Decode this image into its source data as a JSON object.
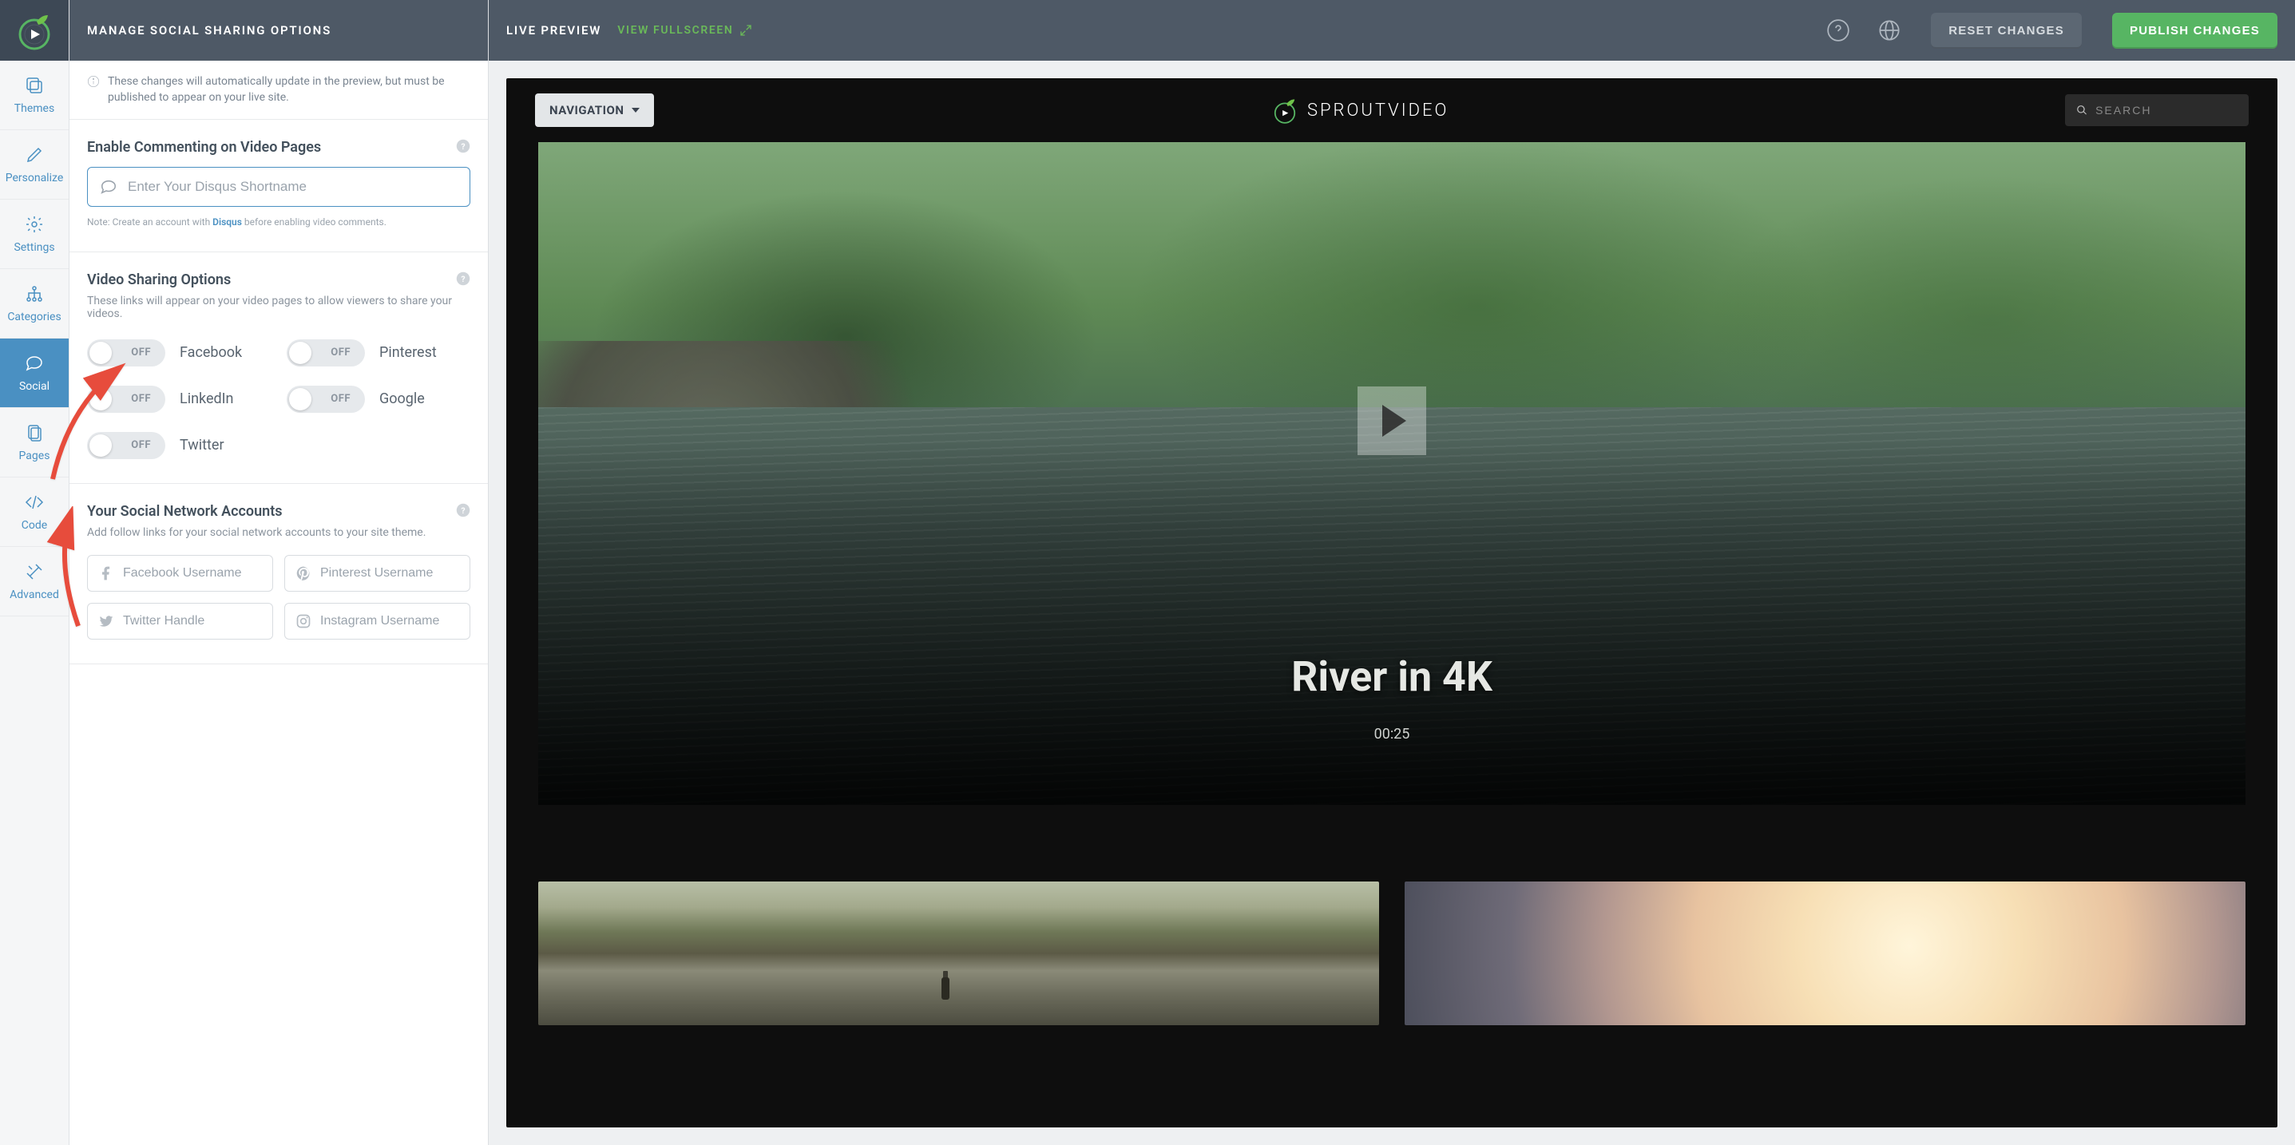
{
  "header": {
    "title": "MANAGE SOCIAL SHARING OPTIONS",
    "live_preview": "LIVE PREVIEW",
    "view_fullscreen": "VIEW FULLSCREEN",
    "reset": "RESET CHANGES",
    "publish": "PUBLISH CHANGES"
  },
  "sidebar": {
    "items": [
      {
        "label": "Themes"
      },
      {
        "label": "Personalize"
      },
      {
        "label": "Settings"
      },
      {
        "label": "Categories"
      },
      {
        "label": "Social"
      },
      {
        "label": "Pages"
      },
      {
        "label": "Code"
      },
      {
        "label": "Advanced"
      }
    ]
  },
  "notice": "These changes will automatically update in the preview, but must be published to appear on your live site.",
  "commenting": {
    "title": "Enable Commenting on Video Pages",
    "placeholder": "Enter Your Disqus Shortname",
    "value": "",
    "note_prefix": "Note: Create an account with ",
    "note_link": "Disqus",
    "note_suffix": " before enabling video comments."
  },
  "sharing": {
    "title": "Video Sharing Options",
    "sub": "These links will appear on your video pages to allow viewers to share your videos.",
    "toggles": [
      {
        "label": "Facebook",
        "state": "OFF",
        "on": false
      },
      {
        "label": "Pinterest",
        "state": "OFF",
        "on": false
      },
      {
        "label": "LinkedIn",
        "state": "OFF",
        "on": false
      },
      {
        "label": "Google",
        "state": "OFF",
        "on": false
      },
      {
        "label": "Twitter",
        "state": "OFF",
        "on": false
      }
    ]
  },
  "accounts": {
    "title": "Your Social Network Accounts",
    "sub": "Add follow links for your social network accounts to your site theme.",
    "fields": [
      {
        "placeholder": "Facebook Username",
        "value": "",
        "icon": "facebook"
      },
      {
        "placeholder": "Pinterest Username",
        "value": "",
        "icon": "pinterest"
      },
      {
        "placeholder": "Twitter Handle",
        "value": "",
        "icon": "twitter"
      },
      {
        "placeholder": "Instagram Username",
        "value": "",
        "icon": "instagram"
      }
    ]
  },
  "preview": {
    "brand": "SPROUTVIDEO",
    "navigation": "NAVIGATION",
    "search_placeholder": "SEARCH",
    "video_title": "River in 4K",
    "duration": "00:25"
  }
}
